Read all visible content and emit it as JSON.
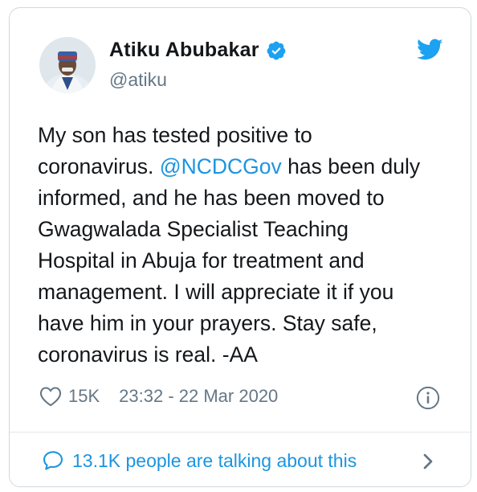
{
  "author": {
    "name": "Atiku Abubakar",
    "handle": "@atiku"
  },
  "tweet": {
    "text_before_mention": "My son has tested positive to\ncoronavirus. ",
    "mention": "@NCDCGov",
    "text_after_mention": " has been duly\ninformed, and he has been moved to\nGwagwalada Specialist Teaching\nHospital in Abuja for treatment and\nmanagement. I will appreciate it if you\nhave him in your prayers. Stay safe,\ncoronavirus is real. -AA"
  },
  "meta": {
    "likes": "15K",
    "timestamp": "23:32 - 22 Mar 2020"
  },
  "footer": {
    "talking_label": "13.1K people are talking about this"
  },
  "icons": {
    "verified": "verified-badge-icon",
    "brand": "twitter-bird-icon",
    "like": "heart-icon",
    "info": "info-icon",
    "reply": "speech-bubble-icon",
    "chevron": "chevron-right-icon"
  },
  "colors": {
    "accent": "#1b95e0",
    "text": "#14171a",
    "muted": "#657786",
    "border": "#cfd9de"
  }
}
